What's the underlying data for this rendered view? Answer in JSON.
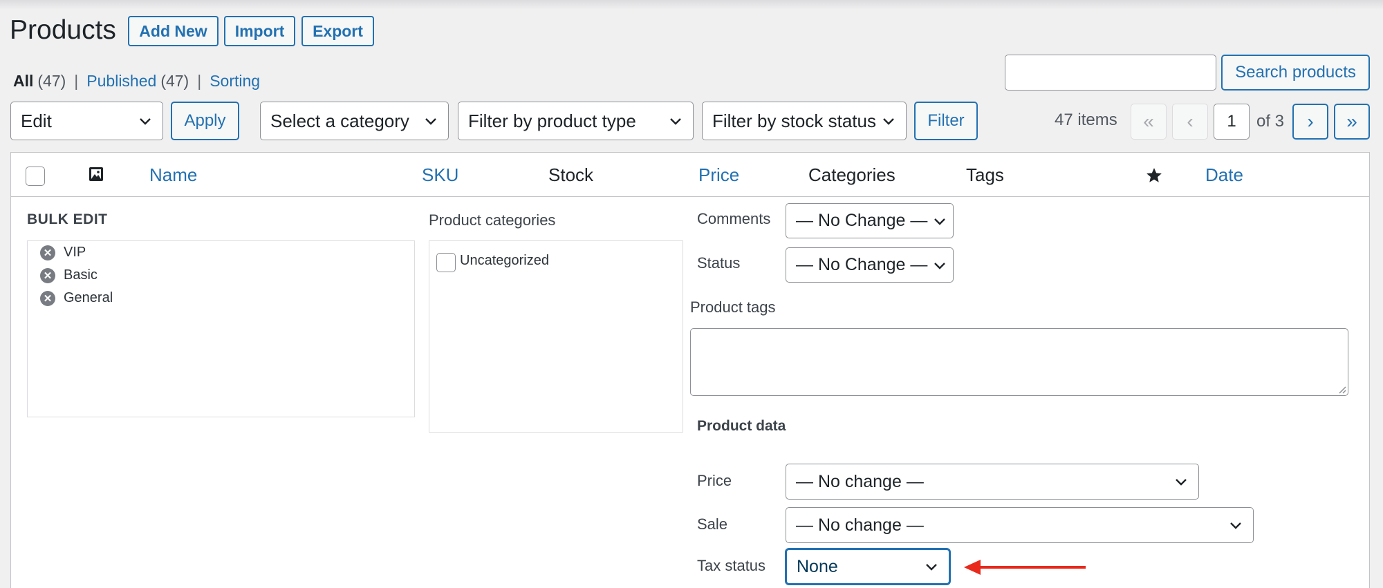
{
  "header": {
    "title": "Products",
    "add_new": "Add New",
    "import": "Import",
    "export": "Export"
  },
  "subsubsub": {
    "all": "All",
    "all_count": "(47)",
    "published": "Published",
    "published_count": "(47)",
    "sorting": "Sorting",
    "separator": "|"
  },
  "search": {
    "value": "",
    "button": "Search products"
  },
  "tablenav": {
    "bulk_action": "Edit",
    "apply": "Apply",
    "category_filter": "Select a category",
    "type_filter": "Filter by product type",
    "stock_filter": "Filter by stock status",
    "filter_button": "Filter",
    "items_count": "47 items",
    "first": "«",
    "prev": "‹",
    "current_page": "1",
    "of_pages": "of 3",
    "next": "›",
    "last": "»"
  },
  "table": {
    "columns": {
      "name": "Name",
      "sku": "SKU",
      "stock": "Stock",
      "price": "Price",
      "categories": "Categories",
      "tags": "Tags",
      "date": "Date"
    }
  },
  "bulk_edit": {
    "title": "BULK EDIT",
    "items": [
      "VIP",
      "Basic",
      "General"
    ],
    "categories_label": "Product categories",
    "categories": [
      {
        "label": "Uncategorized",
        "checked": false
      }
    ],
    "comments_label": "Comments",
    "comments_value": "— No Change —",
    "status_label": "Status",
    "status_value": "— No Change —",
    "tags_label": "Product tags",
    "tags_value": "",
    "product_data_label": "Product data",
    "price_label": "Price",
    "price_value": "— No change —",
    "sale_label": "Sale",
    "sale_value": "— No change —",
    "tax_status_label": "Tax status",
    "tax_status_value": "None"
  },
  "colors": {
    "accent": "#2271b1",
    "annotation_arrow": "#e8291c",
    "background": "#f0f0f1"
  }
}
